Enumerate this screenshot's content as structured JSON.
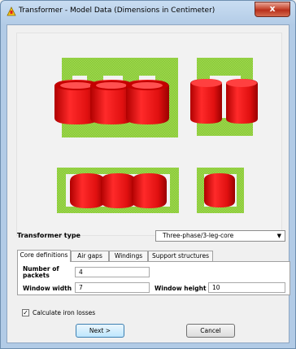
{
  "window": {
    "title": "Transformer - Model Data (Dimensions in Centimeter)",
    "close_label": "x"
  },
  "colors": {
    "core": "#9bd64a",
    "winding": "#e01818",
    "accent": "#3c7fb1"
  },
  "type_row": {
    "label": "Transformer type",
    "selected": "Three-phase/3-leg-core"
  },
  "tabs": [
    {
      "label": "Core definitions",
      "active": true
    },
    {
      "label": "Air gaps",
      "active": false
    },
    {
      "label": "Windings",
      "active": false
    },
    {
      "label": "Support structures",
      "active": false
    }
  ],
  "core_definitions": {
    "packets_label": "Number of packets",
    "packets_value": "4",
    "window_width_label": "Window width",
    "window_width_value": "7",
    "window_height_label": "Window height",
    "window_height_value": "10"
  },
  "iron_losses": {
    "label": "Calculate iron losses",
    "checked": true
  },
  "buttons": {
    "next": "Next >",
    "cancel": "Cancel"
  }
}
